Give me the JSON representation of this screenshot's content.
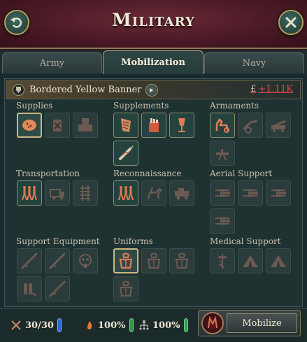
{
  "header": {
    "title": "Military"
  },
  "tabs": [
    {
      "label": "Army",
      "active": false
    },
    {
      "label": "Mobilization",
      "active": true
    },
    {
      "label": "Navy",
      "active": false
    }
  ],
  "banner": {
    "name": "Bordered Yellow Banner",
    "currency_symbol": "£",
    "cost": "+1.11K"
  },
  "categories": {
    "supplies": {
      "label": "Supplies",
      "options": [
        "food-ration-icon",
        "canned-goods-icon",
        "stacked-crates-icon"
      ]
    },
    "supplements": {
      "label": "Supplements",
      "options": [
        "tobacco-icon",
        "cigarette-pack-icon",
        "wine-glass-icon",
        "morphine-icon"
      ]
    },
    "armaments": {
      "label": "Armaments",
      "options": [
        "horse-artillery-icon",
        "field-gun-icon",
        "heavy-artillery-icon",
        "machine-gun-icon"
      ]
    },
    "transportation": {
      "label": "Transportation",
      "options": [
        "marching-infantry-icon",
        "truck-icon",
        "railway-icon"
      ]
    },
    "reconnaissance": {
      "label": "Reconnaissance",
      "options": [
        "marching-infantry-icon",
        "cavalry-icon",
        "armored-car-icon"
      ]
    },
    "aerial_support": {
      "label": "Aerial Support",
      "options": [
        "biplane-icon",
        "biplane-icon",
        "biplane-icon",
        "biplane-icon"
      ]
    },
    "support_equipment": {
      "label": "Support Equipment",
      "options": [
        "rifle-icon",
        "rifle-icon",
        "gas-mask-icon",
        "flamethrower-icon",
        "rifle-icon"
      ]
    },
    "uniforms": {
      "label": "Uniforms",
      "options": [
        "uniform-icon",
        "uniform-icon",
        "uniform-icon",
        "uniform-icon"
      ]
    },
    "medical_support": {
      "label": "Medical Support",
      "options": [
        "caduceus-icon",
        "field-tent-icon",
        "field-tent-icon"
      ]
    }
  },
  "footer": {
    "units": "30/30",
    "morale": "100%",
    "organization": "100%",
    "mobilize_label": "Mobilize"
  },
  "colors": {
    "accent_gold": "#cdb77e",
    "cost_red": "#e04a4a",
    "bar_blue": "#2a6ad8",
    "bar_green": "#2f9a4a"
  }
}
